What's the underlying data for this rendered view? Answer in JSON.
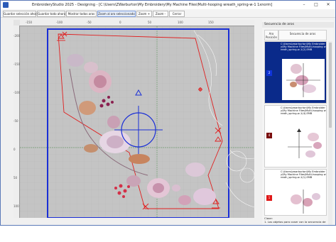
{
  "window": {
    "title": "EmbroideryStudio 2025 - Designing - [C:\\Users\\ZWarburton\\My Embroidery\\My Machine Files\\Multi-hooping wreath_spring-w-1     1xnorm]",
    "controls": {
      "minimize": "–",
      "maximize": "□",
      "close": "✕"
    }
  },
  "toolbar": {
    "buttons": [
      "Guardar selección ahora",
      "Guardar todo ahora",
      "Mostrar todos aros",
      "Zoom al aro seleccionado",
      "Zoom +",
      "Zoom -",
      "Cerrar"
    ]
  },
  "rulers": {
    "top": [
      "-150",
      "-100",
      "-50",
      "0",
      "50",
      "100",
      "150"
    ],
    "left": [
      "-200",
      "-150",
      "-100",
      "-50",
      "0",
      "50",
      "100"
    ]
  },
  "panel": {
    "title": "Secuencia de aros",
    "col_position": "Aro Posición",
    "col_sequence": "Secuencia de aros",
    "rows": [
      {
        "position": "2",
        "path": "C:\\Users\\zwarburton\\My Embroidery\\My Machine Files\\Multi-hooping wreath_spring-w-1(2).EMB",
        "selected": true,
        "badge_color": "#1034d8"
      },
      {
        "position": "4",
        "path": "C:\\Users\\zwarburton\\My Embroidery\\My Machine Files\\Multi-hooping wreath_spring-w-1(4).EMB",
        "selected": false,
        "badge_color": "#7a0e0e"
      },
      {
        "position": "1",
        "path": "C:\\Users\\zwarburton\\My Embroidery\\My Machine Files\\Multi-hooping wreath_spring-w-1(1).EMB",
        "selected": false,
        "badge_color": "#e01818"
      }
    ],
    "footer_label": "Clave:",
    "footer_text": "1. Los objetos para coser con la secuencia de"
  },
  "colors": {
    "hoop": "#1a2fd6",
    "selection": "#e02020",
    "accent": "#0a2a8a",
    "canvas": "#c4c4c4"
  },
  "icons": [
    "app-icon",
    "crosshair-icon",
    "triangle-icon",
    "cross-marker-icon"
  ]
}
